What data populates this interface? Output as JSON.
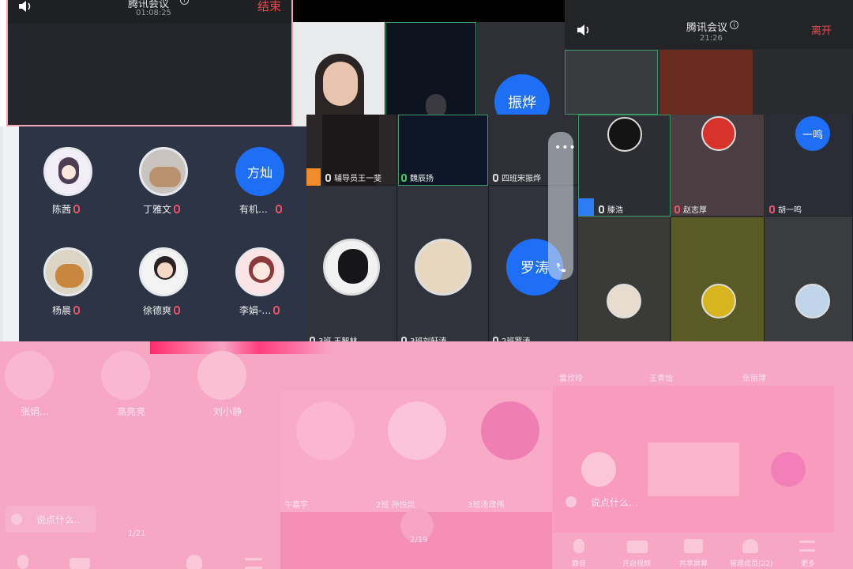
{
  "meeting_left": {
    "title": "腾讯会议",
    "timer": "01:08:25",
    "end_label": "结束"
  },
  "meeting_right": {
    "title": "腾讯会议",
    "timer": "21:26",
    "leave_label": "离开"
  },
  "left_grid": {
    "participants": [
      {
        "name": "陈茜"
      },
      {
        "name": "丁雅文"
      },
      {
        "name": "有机…",
        "avatar_text": "方灿"
      },
      {
        "name": "杨晨"
      },
      {
        "name": "徐德爽"
      },
      {
        "name": "李娟-…"
      }
    ]
  },
  "middle_grid": {
    "tiles": [
      {
        "label": "辅导员王一斐"
      },
      {
        "label": "魏辰扬"
      },
      {
        "label": "四班宋振烨",
        "avatar_text": "振烨"
      },
      {
        "label": "3班 王智林"
      },
      {
        "label": "3班刘轩涛"
      },
      {
        "label": "2班罗涛",
        "avatar_text": "罗涛"
      }
    ]
  },
  "right_grid": {
    "tiles": [
      {
        "label": "滕浩"
      },
      {
        "label": "赵志厚"
      },
      {
        "label": "胡一鸣",
        "avatar_text": "一鸣"
      }
    ]
  },
  "bottom_pink": {
    "left_names": [
      "张娟…",
      "高亮亮",
      "刘小静"
    ],
    "middle_names": [
      "牛嘉宇",
      "2班 孙悦凯",
      "3班汤政伟"
    ],
    "right_top_names": [
      "雷欣玲",
      "王青恰",
      "张丽萍"
    ],
    "say_placeholder_left": "说点什么...",
    "say_placeholder_right": "说点什么...",
    "page_left": "1/21",
    "page_mid": "2/19",
    "toolbar_right": [
      "静音",
      "开启视频",
      "共享屏幕",
      "管理成员(22)",
      "更多"
    ]
  },
  "colors": {
    "accent_blue": "#1e6ff5",
    "end_red": "#e94a4a",
    "pink_overlay": "#f7a6c4"
  }
}
